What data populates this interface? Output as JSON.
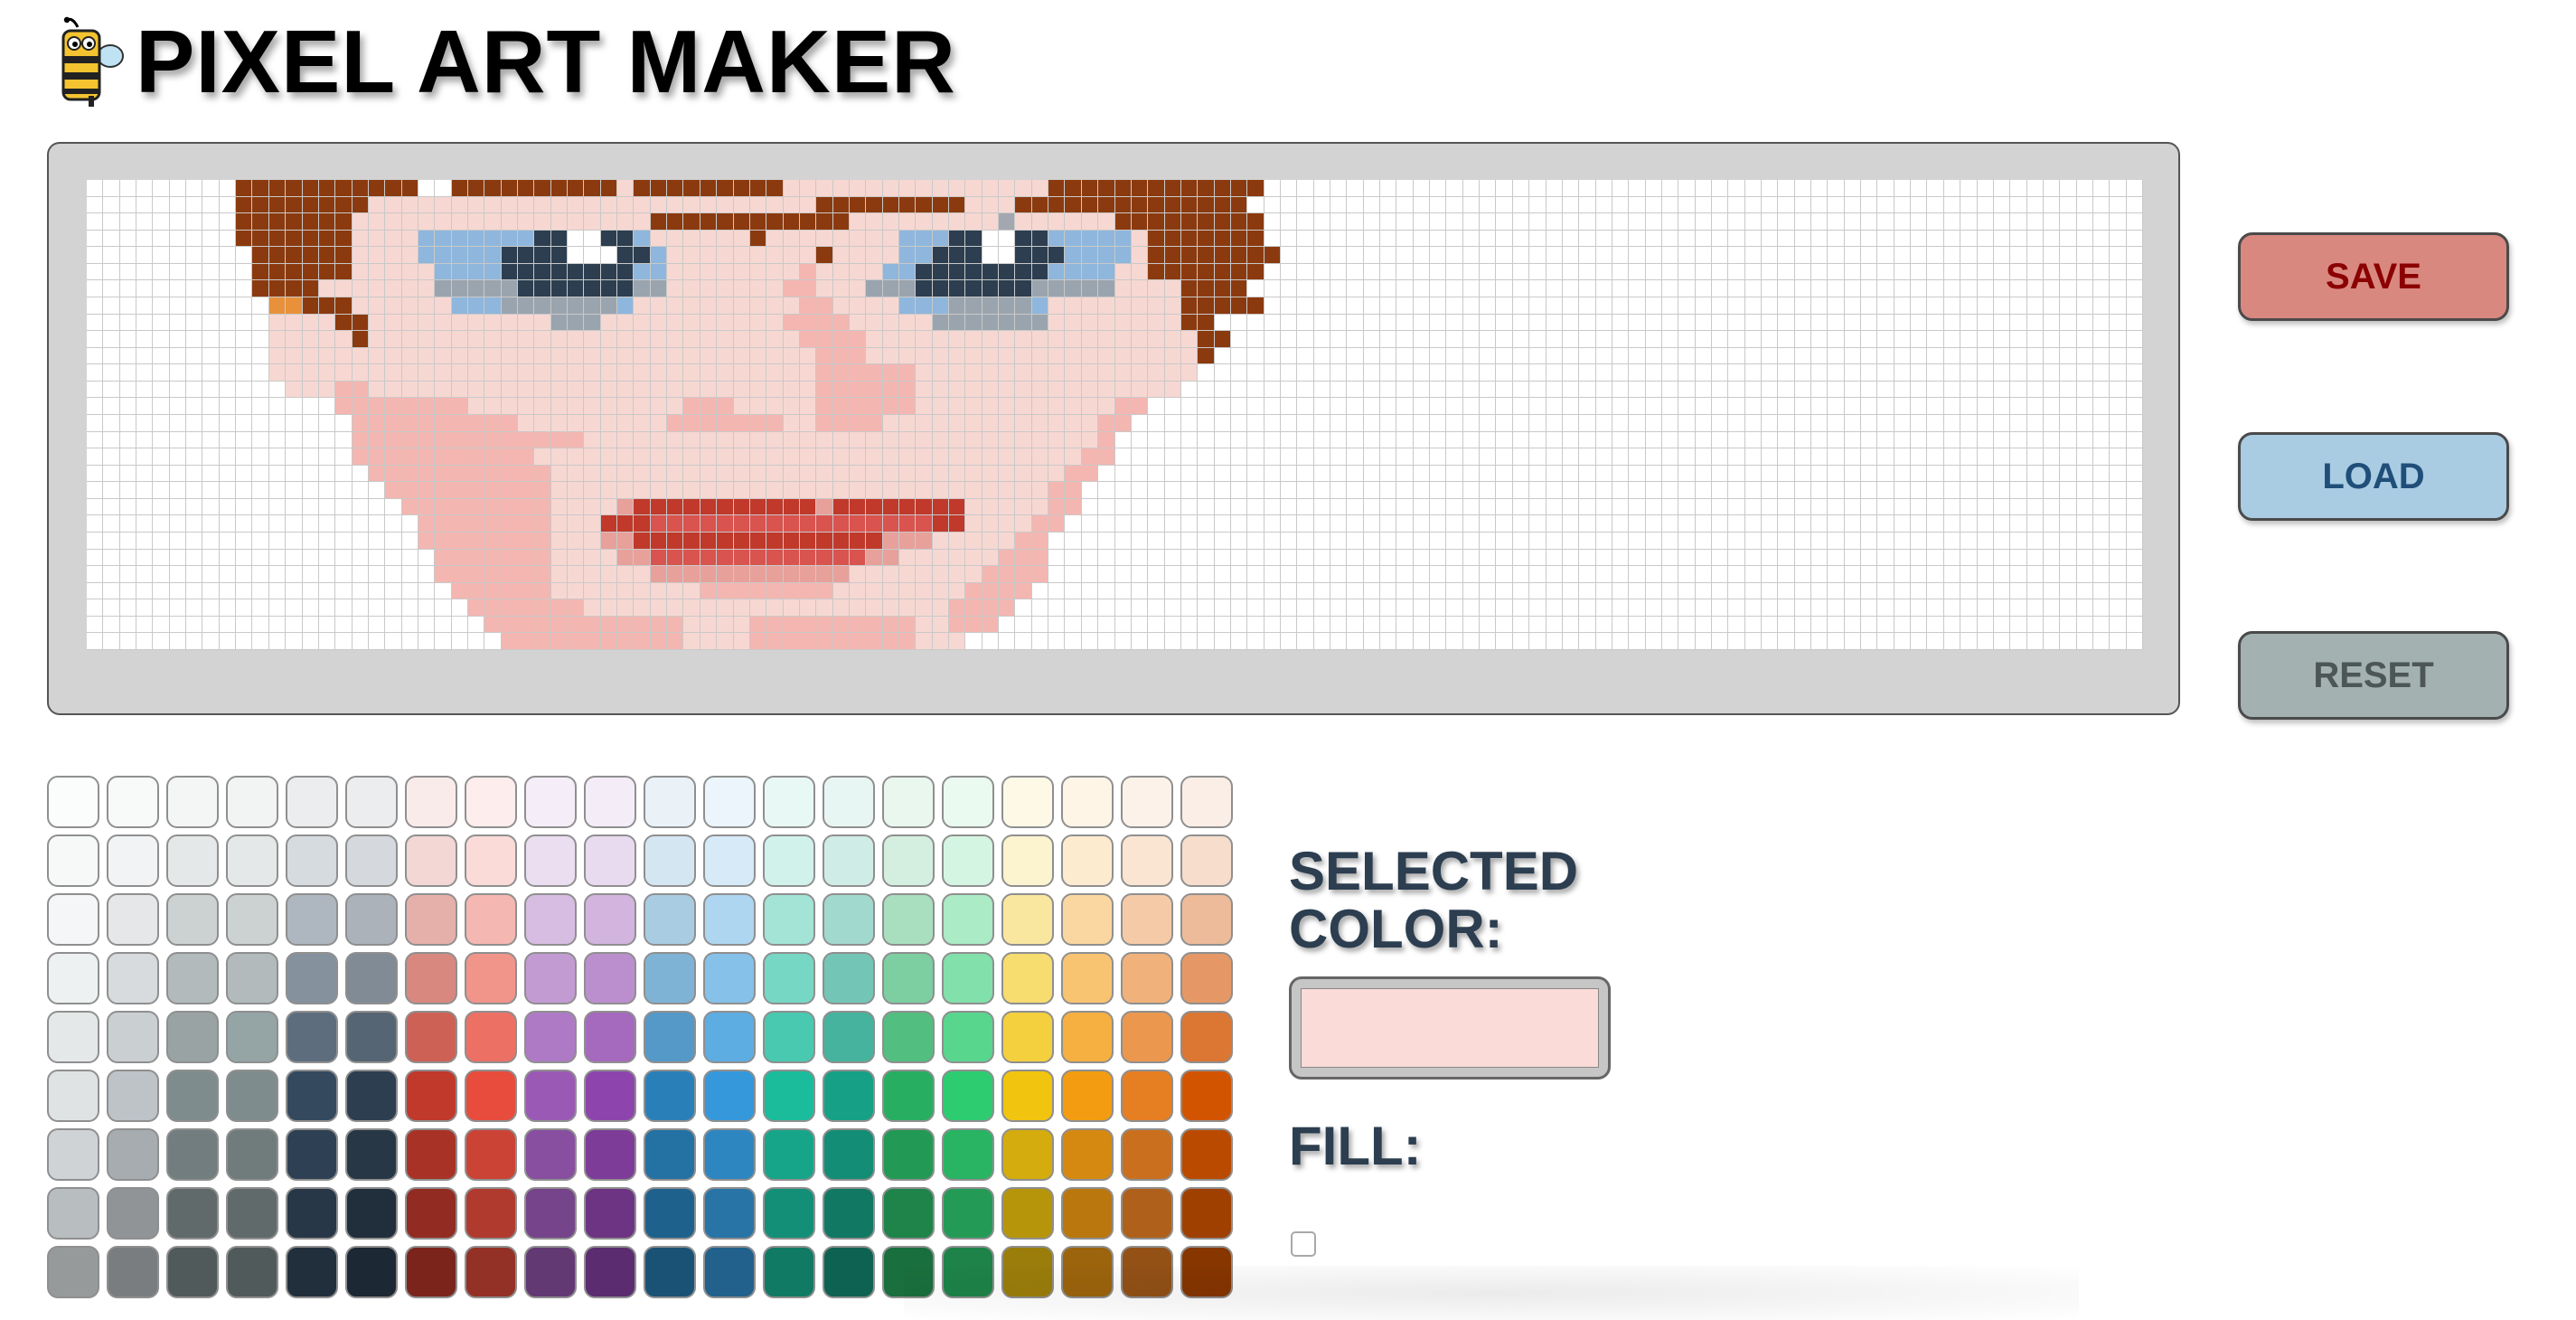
{
  "app": {
    "title": "PIXEL ART MAKER"
  },
  "grid": {
    "columns": 124,
    "rows": 28,
    "background": "#ffffff",
    "line_color": "#c9c9c9",
    "pixels": [
      {
        "r": 0,
        "spans": [
          [
            9,
            20,
            "#8b3a0f"
          ],
          [
            22,
            32,
            "#8b3a0f"
          ],
          [
            32,
            39,
            "#f7d7d2"
          ],
          [
            33,
            62,
            "#8b3a0f"
          ],
          [
            42,
            58,
            "#f7d7d2"
          ],
          [
            62,
            71,
            "#8b3a0f"
          ]
        ]
      },
      {
        "r": 1,
        "spans": [
          [
            9,
            17,
            "#8b3a0f"
          ],
          [
            17,
            56,
            "#f7d7d2"
          ],
          [
            44,
            53,
            "#8b3a0f"
          ],
          [
            56,
            62,
            "#8b3a0f"
          ],
          [
            62,
            70,
            "#8b3a0f"
          ]
        ]
      },
      {
        "r": 2,
        "spans": [
          [
            9,
            16,
            "#8b3a0f"
          ],
          [
            16,
            62,
            "#f7d7d2"
          ],
          [
            34,
            46,
            "#8b3a0f"
          ],
          [
            40,
            41,
            "#8b3a0f"
          ],
          [
            44,
            46,
            "#8b3a0f"
          ],
          [
            55,
            56,
            "#a3a8b0"
          ],
          [
            62,
            71,
            "#8b3a0f"
          ]
        ]
      },
      {
        "r": 3,
        "spans": [
          [
            9,
            16,
            "#8b3a0f"
          ],
          [
            16,
            64,
            "#f7d7d2"
          ],
          [
            20,
            34,
            "#8fb6dc"
          ],
          [
            27,
            33,
            "#2c3e50"
          ],
          [
            29,
            31,
            "#ffffff"
          ],
          [
            40,
            41,
            "#8b3a0f"
          ],
          [
            49,
            63,
            "#8fb6dc"
          ],
          [
            52,
            58,
            "#2c3e50"
          ],
          [
            54,
            56,
            "#ffffff"
          ],
          [
            64,
            71,
            "#8b3a0f"
          ]
        ]
      },
      {
        "r": 4,
        "spans": [
          [
            10,
            16,
            "#8b3a0f"
          ],
          [
            16,
            64,
            "#f7d7d2"
          ],
          [
            20,
            35,
            "#8fb6dc"
          ],
          [
            25,
            34,
            "#2c3e50"
          ],
          [
            29,
            32,
            "#ffffff"
          ],
          [
            44,
            45,
            "#8b3a0f"
          ],
          [
            49,
            63,
            "#8fb6dc"
          ],
          [
            51,
            59,
            "#2c3e50"
          ],
          [
            54,
            56,
            "#ffffff"
          ],
          [
            64,
            72,
            "#8b3a0f"
          ]
        ]
      },
      {
        "r": 5,
        "spans": [
          [
            10,
            16,
            "#8b3a0f"
          ],
          [
            16,
            64,
            "#f7d7d2"
          ],
          [
            21,
            35,
            "#8fb6dc"
          ],
          [
            25,
            33,
            "#2c3e50"
          ],
          [
            43,
            44,
            "#f4b6b1"
          ],
          [
            48,
            62,
            "#8fb6dc"
          ],
          [
            50,
            58,
            "#2c3e50"
          ],
          [
            64,
            71,
            "#8b3a0f"
          ]
        ]
      },
      {
        "r": 6,
        "spans": [
          [
            10,
            14,
            "#8b3a0f"
          ],
          [
            14,
            66,
            "#f7d7d2"
          ],
          [
            21,
            35,
            "#9aa4ae"
          ],
          [
            26,
            33,
            "#2c3e50"
          ],
          [
            42,
            44,
            "#f4b6b1"
          ],
          [
            47,
            62,
            "#9aa4ae"
          ],
          [
            50,
            57,
            "#2c3e50"
          ],
          [
            66,
            70,
            "#8b3a0f"
          ]
        ]
      },
      {
        "r": 7,
        "spans": [
          [
            11,
            13,
            "#e8913a"
          ],
          [
            13,
            16,
            "#8b3a0f"
          ],
          [
            16,
            66,
            "#f7d7d2"
          ],
          [
            22,
            33,
            "#8fb6dc"
          ],
          [
            25,
            32,
            "#9aa4ae"
          ],
          [
            43,
            45,
            "#f4b6b1"
          ],
          [
            49,
            58,
            "#8fb6dc"
          ],
          [
            52,
            57,
            "#9aa4ae"
          ],
          [
            66,
            71,
            "#8b3a0f"
          ]
        ]
      },
      {
        "r": 8,
        "spans": [
          [
            11,
            15,
            "#f7d7d2"
          ],
          [
            15,
            17,
            "#8b3a0f"
          ],
          [
            17,
            66,
            "#f7d7d2"
          ],
          [
            28,
            31,
            "#9aa4ae"
          ],
          [
            42,
            46,
            "#f4b6b1"
          ],
          [
            51,
            58,
            "#9aa4ae"
          ],
          [
            66,
            68,
            "#8b3a0f"
          ]
        ]
      },
      {
        "r": 9,
        "spans": [
          [
            11,
            16,
            "#f7d7d2"
          ],
          [
            16,
            17,
            "#8b3a0f"
          ],
          [
            17,
            67,
            "#f7d7d2"
          ],
          [
            43,
            47,
            "#f4b6b1"
          ],
          [
            67,
            69,
            "#8b3a0f"
          ]
        ]
      },
      {
        "r": 10,
        "spans": [
          [
            11,
            17,
            "#f7d7d2"
          ],
          [
            17,
            67,
            "#f7d7d2"
          ],
          [
            44,
            47,
            "#f4b6b1"
          ],
          [
            67,
            68,
            "#8b3a0f"
          ]
        ]
      },
      {
        "r": 11,
        "spans": [
          [
            11,
            67,
            "#f7d7d2"
          ],
          [
            44,
            50,
            "#f4b6b1"
          ]
        ]
      },
      {
        "r": 12,
        "spans": [
          [
            12,
            66,
            "#f7d7d2"
          ],
          [
            15,
            17,
            "#f4b6b1"
          ],
          [
            44,
            50,
            "#f4b6b1"
          ]
        ]
      },
      {
        "r": 13,
        "spans": [
          [
            15,
            64,
            "#f7d7d2"
          ],
          [
            15,
            23,
            "#f4b6b1"
          ],
          [
            36,
            39,
            "#f4b6b1"
          ],
          [
            44,
            50,
            "#f4b6b1"
          ],
          [
            62,
            64,
            "#f4b6b1"
          ]
        ]
      },
      {
        "r": 14,
        "spans": [
          [
            16,
            63,
            "#f7d7d2"
          ],
          [
            16,
            26,
            "#f4b6b1"
          ],
          [
            35,
            42,
            "#f4b6b1"
          ],
          [
            44,
            48,
            "#f4b6b1"
          ],
          [
            61,
            63,
            "#f4b6b1"
          ]
        ]
      },
      {
        "r": 15,
        "spans": [
          [
            16,
            62,
            "#f7d7d2"
          ],
          [
            16,
            30,
            "#f4b6b1"
          ],
          [
            61,
            62,
            "#f4b6b1"
          ]
        ]
      },
      {
        "r": 16,
        "spans": [
          [
            16,
            62,
            "#f7d7d2"
          ],
          [
            16,
            27,
            "#f4b6b1"
          ],
          [
            60,
            62,
            "#f4b6b1"
          ]
        ]
      },
      {
        "r": 17,
        "spans": [
          [
            17,
            61,
            "#f7d7d2"
          ],
          [
            17,
            28,
            "#f4b6b1"
          ],
          [
            59,
            61,
            "#f4b6b1"
          ]
        ]
      },
      {
        "r": 18,
        "spans": [
          [
            18,
            60,
            "#f7d7d2"
          ],
          [
            18,
            28,
            "#f4b6b1"
          ],
          [
            58,
            60,
            "#f4b6b1"
          ]
        ]
      },
      {
        "r": 19,
        "spans": [
          [
            19,
            60,
            "#f7d7d2"
          ],
          [
            19,
            28,
            "#f4b6b1"
          ],
          [
            32,
            45,
            "#e8a09a"
          ],
          [
            33,
            44,
            "#c0392b"
          ],
          [
            45,
            53,
            "#c0392b"
          ],
          [
            58,
            60,
            "#f4b6b1"
          ]
        ]
      },
      {
        "r": 20,
        "spans": [
          [
            20,
            59,
            "#f7d7d2"
          ],
          [
            20,
            28,
            "#f4b6b1"
          ],
          [
            31,
            53,
            "#c0392b"
          ],
          [
            34,
            51,
            "#d9534f"
          ],
          [
            57,
            59,
            "#f4b6b1"
          ]
        ]
      },
      {
        "r": 21,
        "spans": [
          [
            20,
            58,
            "#f7d7d2"
          ],
          [
            20,
            28,
            "#f4b6b1"
          ],
          [
            31,
            51,
            "#e8a09a"
          ],
          [
            33,
            48,
            "#c0392b"
          ],
          [
            56,
            58,
            "#f4b6b1"
          ]
        ]
      },
      {
        "r": 22,
        "spans": [
          [
            21,
            58,
            "#f7d7d2"
          ],
          [
            21,
            28,
            "#f4b6b1"
          ],
          [
            32,
            49,
            "#e8a09a"
          ],
          [
            34,
            47,
            "#d9534f"
          ],
          [
            55,
            58,
            "#f4b6b1"
          ]
        ]
      },
      {
        "r": 23,
        "spans": [
          [
            21,
            58,
            "#f7d7d2"
          ],
          [
            21,
            28,
            "#f4b6b1"
          ],
          [
            34,
            46,
            "#e8a09a"
          ],
          [
            54,
            58,
            "#f4b6b1"
          ]
        ]
      },
      {
        "r": 24,
        "spans": [
          [
            22,
            57,
            "#f7d7d2"
          ],
          [
            22,
            28,
            "#f4b6b1"
          ],
          [
            37,
            45,
            "#f4b6b1"
          ],
          [
            53,
            57,
            "#f4b6b1"
          ]
        ]
      },
      {
        "r": 25,
        "spans": [
          [
            23,
            56,
            "#f7d7d2"
          ],
          [
            23,
            30,
            "#f4b6b1"
          ],
          [
            52,
            56,
            "#f4b6b1"
          ]
        ]
      },
      {
        "r": 26,
        "spans": [
          [
            24,
            55,
            "#f7d7d2"
          ],
          [
            24,
            36,
            "#f4b6b1"
          ],
          [
            40,
            50,
            "#f4b6b1"
          ],
          [
            52,
            55,
            "#f4b6b1"
          ]
        ]
      },
      {
        "r": 27,
        "spans": [
          [
            25,
            53,
            "#f7d7d2"
          ],
          [
            25,
            36,
            "#f4b6b1"
          ],
          [
            40,
            50,
            "#f4b6b1"
          ]
        ]
      }
    ]
  },
  "buttons": {
    "save": {
      "label": "SAVE",
      "color": "#d98880",
      "text_color": "#8b0000"
    },
    "load": {
      "label": "LOAD",
      "color": "#a9cce3",
      "text_color": "#1f4e79"
    },
    "reset": {
      "label": "RESET",
      "color": "#a3b1b1",
      "text_color": "#4d5656"
    }
  },
  "palette": {
    "columns": 20,
    "rows": 9,
    "swatches": [
      [
        "#fbfcfc",
        "#f8f9f9",
        "#f4f6f6",
        "#f2f4f4",
        "#ebedef",
        "#ebedef",
        "#f9ebea",
        "#fdedec",
        "#f5eef8",
        "#f4ecf7",
        "#eaf2f8",
        "#ebf5fb",
        "#e8f8f5",
        "#e8f6f3",
        "#e9f7ef",
        "#eafaf1",
        "#fef9e7",
        "#fef5e7",
        "#fdf2e9",
        "#fbeee6"
      ],
      [
        "#f7f9f9",
        "#f2f3f4",
        "#e5e8e8",
        "#e5e8e8",
        "#d6dbdf",
        "#d5d8dc",
        "#f2d7d5",
        "#fadbd8",
        "#ebdef0",
        "#e8daef",
        "#d4e6f1",
        "#d6eaf8",
        "#d1f2eb",
        "#d0ece7",
        "#d4efdf",
        "#d5f5e3",
        "#fcf3cf",
        "#fdebd0",
        "#fae5d3",
        "#f6ddcc"
      ],
      [
        "#f4f6f7",
        "#e5e7e9",
        "#ccd1d1",
        "#ccd1d1",
        "#aeb6bf",
        "#abb2b9",
        "#e6b0aa",
        "#f5b7b1",
        "#d7bde2",
        "#d2b4de",
        "#a9cce3",
        "#aed6f1",
        "#a3e4d7",
        "#a2d9ce",
        "#a9dfbf",
        "#abebc6",
        "#f9e79f",
        "#fad7a0",
        "#f5cba7",
        "#edbb99"
      ],
      [
        "#eef1f1",
        "#d7dbdd",
        "#b2babb",
        "#b2babb",
        "#85929e",
        "#808b96",
        "#d98880",
        "#f1948a",
        "#c39bd3",
        "#bb8fce",
        "#7fb3d5",
        "#85c1e9",
        "#76d7c4",
        "#73c6b6",
        "#7dcea0",
        "#82e0aa",
        "#f7dc6f",
        "#f8c471",
        "#f0b27a",
        "#e59866"
      ],
      [
        "#e5e8e8",
        "#cacfd2",
        "#99a3a4",
        "#95a5a6",
        "#5d6d7e",
        "#566573",
        "#cd6155",
        "#ec7063",
        "#af7ac5",
        "#a569bd",
        "#5499c7",
        "#5dade2",
        "#48c9b0",
        "#45b39d",
        "#52be80",
        "#58d68d",
        "#f4d03f",
        "#f5b041",
        "#eb984e",
        "#dc7633"
      ],
      [
        "#e0e3e3",
        "#bdc3c7",
        "#7f8c8d",
        "#7f8c8d",
        "#34495e",
        "#2c3e50",
        "#c0392b",
        "#e74c3c",
        "#9b59b6",
        "#8e44ad",
        "#2980b9",
        "#3498db",
        "#1abc9c",
        "#16a085",
        "#27ae60",
        "#2ecc71",
        "#f1c40f",
        "#f39c12",
        "#e67e22",
        "#d35400"
      ],
      [
        "#cfd3d5",
        "#a6acaf",
        "#717d7e",
        "#707b7c",
        "#2e4053",
        "#273746",
        "#a93226",
        "#cb4335",
        "#884ea0",
        "#7d3c98",
        "#2471a3",
        "#2e86c1",
        "#17a589",
        "#138d75",
        "#229954",
        "#28b463",
        "#d4ac0d",
        "#d68910",
        "#ca6f1e",
        "#ba4a00"
      ],
      [
        "#b8bdbf",
        "#909497",
        "#616a6b",
        "#616a6b",
        "#283747",
        "#212f3c",
        "#922b21",
        "#b03a2e",
        "#76448a",
        "#6c3483",
        "#1f618d",
        "#2874a6",
        "#148f77",
        "#117864",
        "#1e8449",
        "#239b56",
        "#b7950b",
        "#b9770e",
        "#af601a",
        "#a04000"
      ],
      [
        "#979a9a",
        "#797d7f",
        "#515a5a",
        "#515a5a",
        "#212f3d",
        "#1c2833",
        "#7b241c",
        "#943126",
        "#633974",
        "#5b2c6f",
        "#1a5276",
        "#21618c",
        "#117a65",
        "#0e6251",
        "#196f3d",
        "#1d8348",
        "#9a7d0a",
        "#9c640c",
        "#935116",
        "#873600"
      ]
    ]
  },
  "selected": {
    "label": "SELECTED\nCOLOR:",
    "color": "#fadbd8"
  },
  "fill": {
    "label": "FILL:",
    "checked": false
  }
}
